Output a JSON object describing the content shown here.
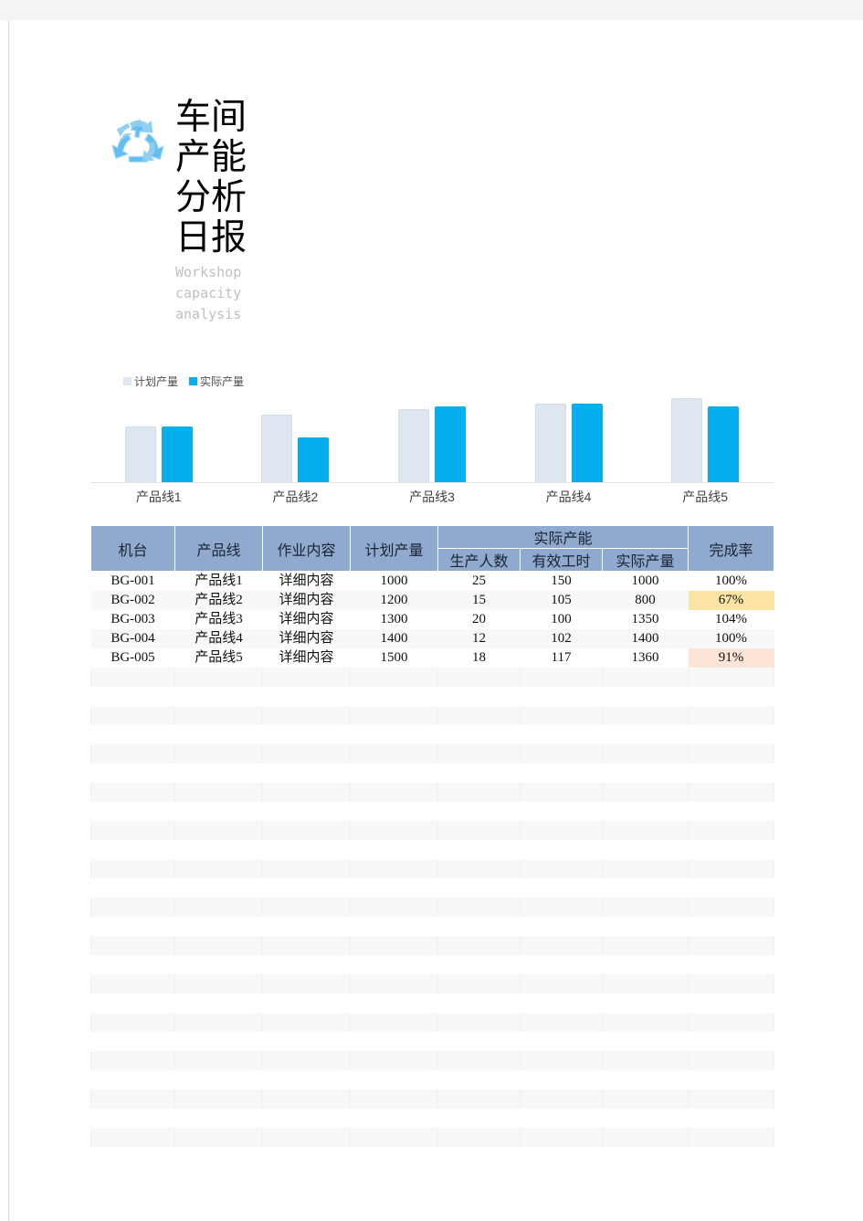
{
  "document": {
    "title_cn": "车间产能分析日报",
    "title_en_line1": "Workshop",
    "title_en_line2": "capacity",
    "title_en_line3": "analysis",
    "logo_icon": "recycle-icon"
  },
  "colors": {
    "header_bg": "#8FAACE",
    "plan_bar": "#DEE7F0",
    "actual_bar": "#06AEEE",
    "stripe": "#F8F8F8",
    "highlight_amber": "#FCE5A4",
    "highlight_peach": "#FCE4D6",
    "subtitle_gray": "#BFBFBF"
  },
  "chart_data": {
    "type": "bar",
    "title": "",
    "xlabel": "",
    "ylabel": "",
    "grid": false,
    "legend_position": "top-left",
    "categories": [
      "产品线1",
      "产品线2",
      "产品线3",
      "产品线4",
      "产品线5"
    ],
    "ylim": [
      0,
      1600
    ],
    "series": [
      {
        "name": "计划产量",
        "color": "#DEE7F0",
        "values": [
          1000,
          1200,
          1300,
          1400,
          1500
        ]
      },
      {
        "name": "实际产量",
        "color": "#06AEEE",
        "values": [
          1000,
          800,
          1350,
          1400,
          1360
        ]
      }
    ]
  },
  "table": {
    "header": {
      "machine": "机台",
      "product_line": "产品线",
      "job_content": "作业内容",
      "planned_output": "计划产量",
      "actual_capacity_group": "实际产能",
      "headcount": "生产人数",
      "effective_hours": "有效工时",
      "actual_output": "实际产量",
      "completion_rate": "完成率"
    },
    "rows": [
      {
        "machine": "BG-001",
        "product_line": "产品线1",
        "job_content": "详细内容",
        "planned_output": "1000",
        "headcount": "25",
        "effective_hours": "150",
        "actual_output": "1000",
        "completion_rate": "100%",
        "highlight": ""
      },
      {
        "machine": "BG-002",
        "product_line": "产品线2",
        "job_content": "详细内容",
        "planned_output": "1200",
        "headcount": "15",
        "effective_hours": "105",
        "actual_output": "800",
        "completion_rate": "67%",
        "highlight": "amber"
      },
      {
        "machine": "BG-003",
        "product_line": "产品线3",
        "job_content": "详细内容",
        "planned_output": "1300",
        "headcount": "20",
        "effective_hours": "100",
        "actual_output": "1350",
        "completion_rate": "104%",
        "highlight": ""
      },
      {
        "machine": "BG-004",
        "product_line": "产品线4",
        "job_content": "详细内容",
        "planned_output": "1400",
        "headcount": "12",
        "effective_hours": "102",
        "actual_output": "1400",
        "completion_rate": "100%",
        "highlight": ""
      },
      {
        "machine": "BG-005",
        "product_line": "产品线5",
        "job_content": "详细内容",
        "planned_output": "1500",
        "headcount": "18",
        "effective_hours": "117",
        "actual_output": "1360",
        "completion_rate": "91%",
        "highlight": "peach"
      }
    ],
    "empty_row_count": 26
  }
}
